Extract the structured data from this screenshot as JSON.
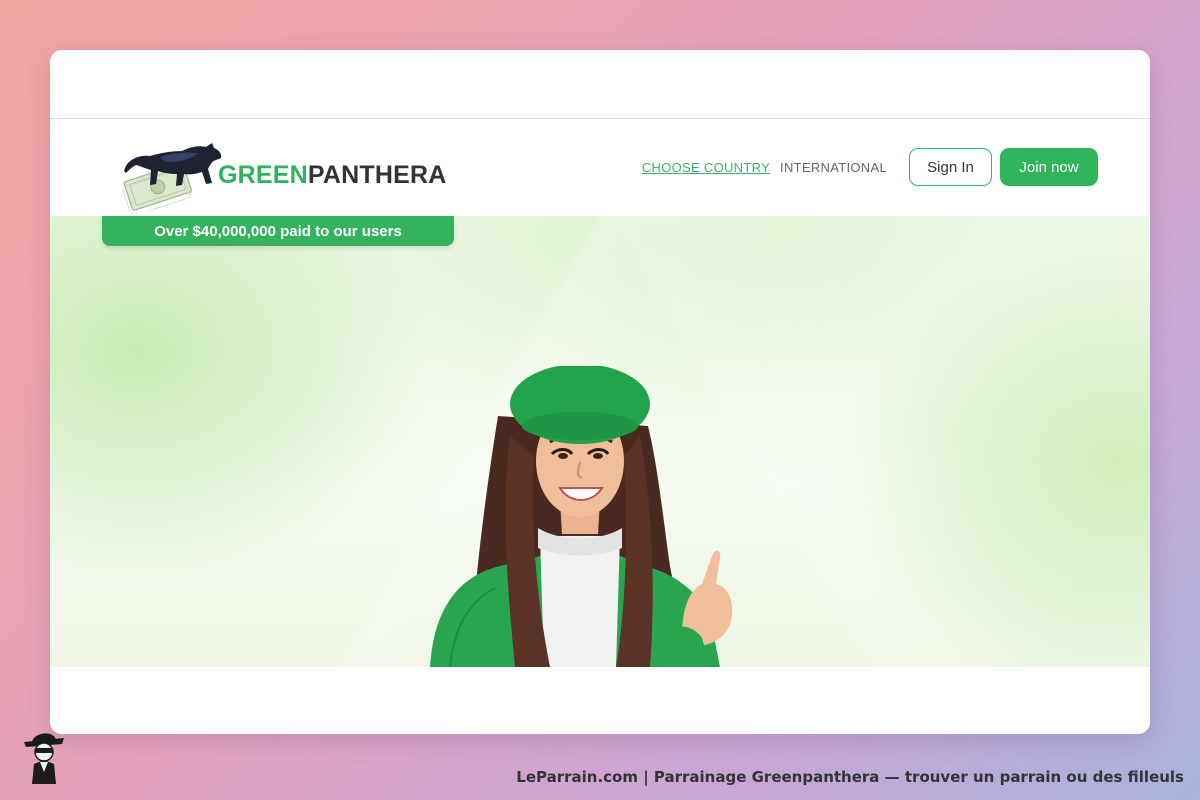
{
  "header": {
    "logo": {
      "green_part": "GREEN",
      "dark_part": "PANTHERA"
    },
    "nav": {
      "choose_country": "CHOOSE COUNTRY",
      "international": "INTERNATIONAL"
    },
    "buttons": {
      "sign_in": "Sign In",
      "join_now": "Join now"
    }
  },
  "hero": {
    "banner_text": "Over $40,000,000 paid to our users"
  },
  "footer": {
    "caption": "LeParrain.com | Parrainage Greenpanthera — trouver un parrain ou des filleuls"
  },
  "colors": {
    "brand_green": "#2fb35b",
    "link_green": "#3bb066",
    "dark_text": "#333333"
  },
  "icons": [
    "panther-logo-icon",
    "money-bill-icon",
    "mascot-icon"
  ]
}
